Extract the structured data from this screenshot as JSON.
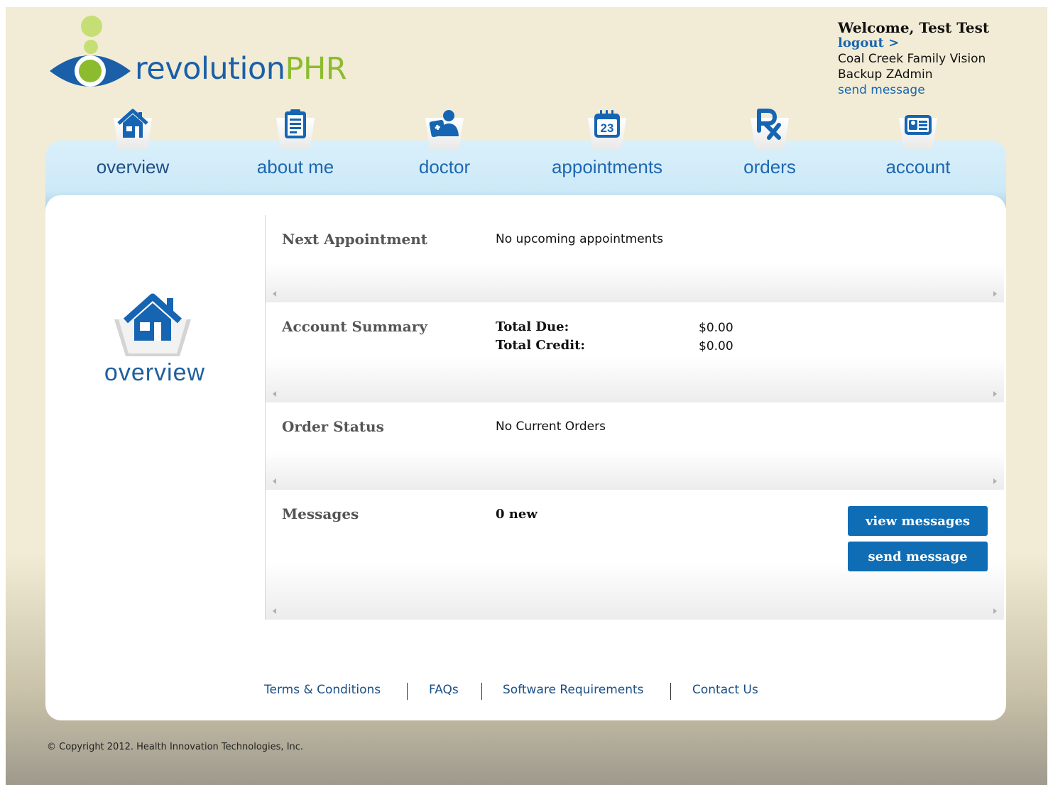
{
  "logo": {
    "part1": "revolution",
    "part2": "PHR"
  },
  "user": {
    "welcome": "Welcome, Test Test",
    "logout": "logout >",
    "practice": "Coal Creek Family Vision",
    "admin": "Backup ZAdmin",
    "send_message": "send message"
  },
  "nav": [
    {
      "label": "overview",
      "icon": "home-icon"
    },
    {
      "label": "about me",
      "icon": "clipboard-icon"
    },
    {
      "label": "doctor",
      "icon": "doctor-icon"
    },
    {
      "label": "appointments",
      "icon": "calendar-icon",
      "calendar_day": "23"
    },
    {
      "label": "orders",
      "icon": "rx-icon"
    },
    {
      "label": "account",
      "icon": "id-card-icon"
    }
  ],
  "sidebar": {
    "title": "overview"
  },
  "sections": {
    "next_appointment": {
      "label": "Next Appointment",
      "value": "No upcoming appointments"
    },
    "account_summary": {
      "label": "Account Summary",
      "total_due_label": "Total Due:",
      "total_due": "$0.00",
      "total_credit_label": "Total Credit:",
      "total_credit": "$0.00"
    },
    "order_status": {
      "label": "Order Status",
      "value": "No Current Orders"
    },
    "messages": {
      "label": "Messages",
      "value": "0 new",
      "view_button": "view messages",
      "send_button": "send message"
    }
  },
  "footer": {
    "links": [
      "Terms & Conditions",
      "FAQs",
      "Software Requirements",
      "Contact Us"
    ],
    "copyright": "© Copyright 2012. Health Innovation Technologies, Inc."
  },
  "colors": {
    "brand_blue": "#1766b0",
    "brand_green": "#8cbc2e",
    "button": "#0f6db5"
  }
}
